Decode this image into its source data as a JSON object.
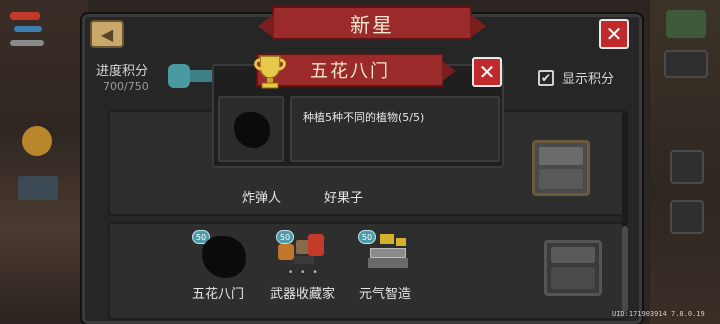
{
  "window": {
    "title": "新星",
    "back_icon": "back-arrow-icon",
    "close_icon": "close-x-icon"
  },
  "progress": {
    "label": "进度积分",
    "value": "700/750"
  },
  "show_points": {
    "label": "显示积分",
    "checked": true
  },
  "rows": [
    {
      "items": [
        {
          "label": "炸弹人",
          "badge": ""
        },
        {
          "label": "好果子",
          "badge": ""
        }
      ]
    },
    {
      "items": [
        {
          "label": "五花八门",
          "badge": "50",
          "unlocked": false
        },
        {
          "label": "武器收藏家",
          "badge": "50",
          "unlocked": true
        },
        {
          "label": "元气智造",
          "badge": "50",
          "unlocked": true
        }
      ]
    }
  ],
  "popup": {
    "title": "五花八门",
    "description": "种植5种不同的植物(5/5)",
    "trophy_icon": "trophy-icon"
  },
  "footer": {
    "uid": "UID:171903914 7.8.0.19"
  },
  "colors": {
    "banner": "#9b2a2a",
    "close": "#c02a2a",
    "badge": "#4f9aa8",
    "panel": "#262626"
  }
}
